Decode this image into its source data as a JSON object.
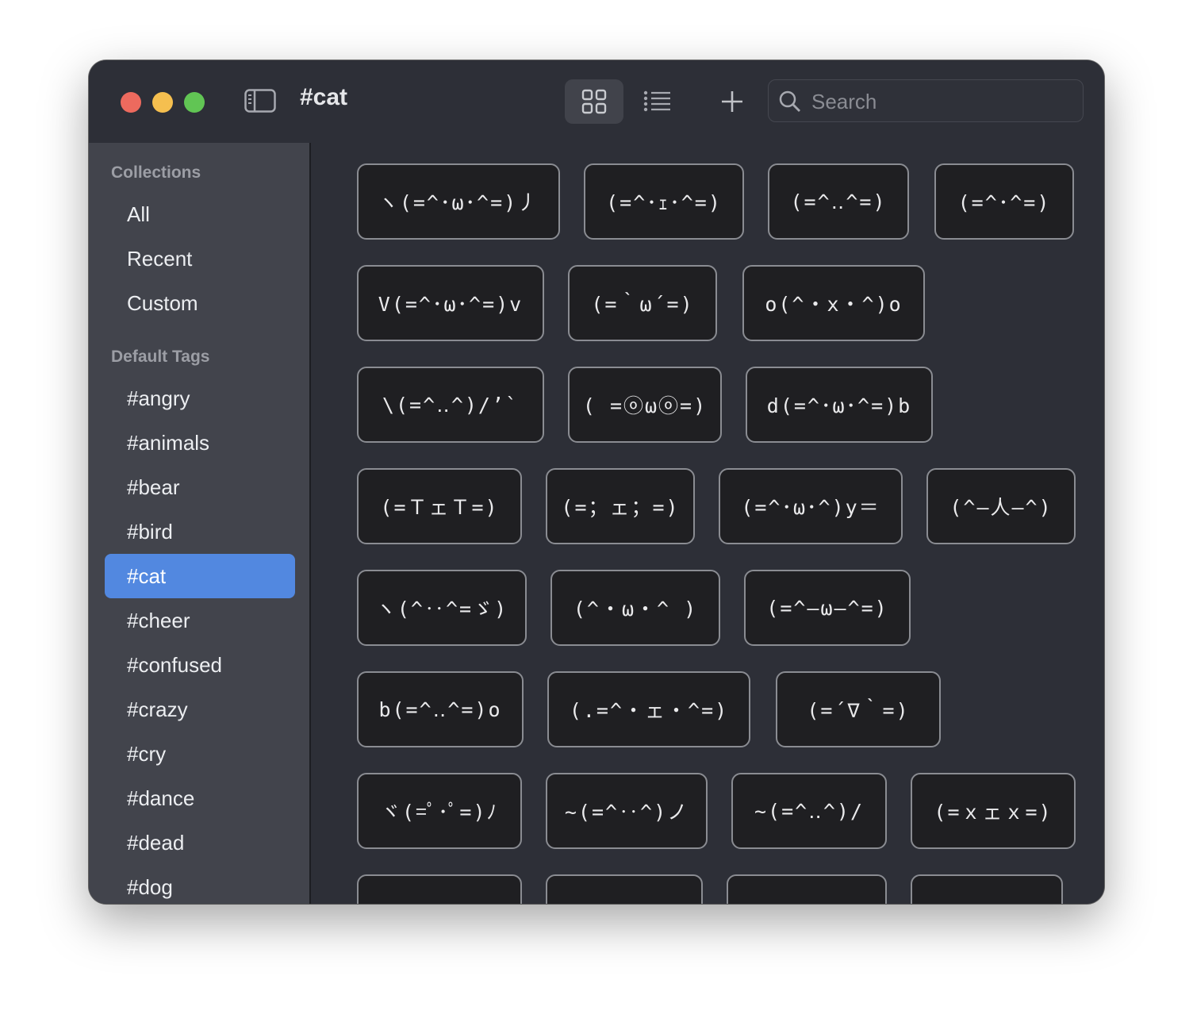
{
  "window": {
    "title": "#cat"
  },
  "toolbar": {
    "search_placeholder": "Search",
    "search_value": ""
  },
  "sidebar": {
    "collections_heading": "Collections",
    "collections": [
      "All",
      "Recent",
      "Custom"
    ],
    "tags_heading": "Default Tags",
    "tags": [
      "#angry",
      "#animals",
      "#bear",
      "#bird",
      "#cat",
      "#cheer",
      "#confused",
      "#crazy",
      "#cry",
      "#dance",
      "#dead",
      "#dog"
    ],
    "selected": "#cat"
  },
  "emoticons": [
    "ヽ(=^･ω･^=)丿",
    "(=^･ｪ･^=)",
    "(=^‥^=)",
    "(=^･^=)",
    "V(=^･ω･^=)v",
    "(=｀ω´=)",
    "o(^・x・^)o",
    "\\(=^‥^)/’`",
    "( =ⓞωⓞ=)",
    "d(=^･ω･^=)b",
    "(=ＴェＴ=)",
    "(=；ェ；=)",
    "(=^･ω･^)y＝",
    "(^–人–^)",
    "ヽ(^‥^=ゞ)",
    "(^・ω・^ )",
    "(=^–ω–^=)",
    "b(=^‥^=)o",
    "(.=^・ェ・^=)",
    "(=´∇｀=)",
    "ヾ(=ﾟ･ﾟ=)ﾉ",
    "~(=^‥^)ノ",
    "~(=^‥^)/",
    "(=ｘェｘ=)",
    "",
    "",
    "",
    ""
  ],
  "colors": {
    "window_bg": "#2d2f37",
    "sidebar_bg": "#42444c",
    "accent": "#5288e0",
    "chip_bg": "#1f1f22",
    "chip_border": "#8a8c92"
  }
}
